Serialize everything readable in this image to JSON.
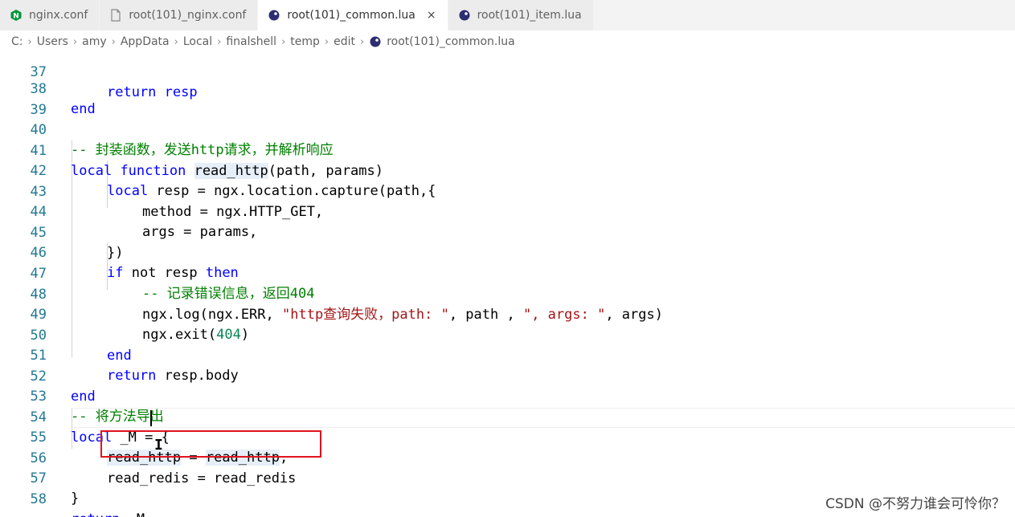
{
  "tabs": [
    {
      "label": "nginx.conf",
      "icon": "nginx-icon",
      "active": false
    },
    {
      "label": "root(101)_nginx.conf",
      "icon": "file-icon",
      "active": false
    },
    {
      "label": "root(101)_common.lua",
      "icon": "lua-icon",
      "active": true,
      "close": "×"
    },
    {
      "label": "root(101)_item.lua",
      "icon": "lua-icon",
      "active": false
    }
  ],
  "breadcrumb": [
    "C:",
    "Users",
    "amy",
    "AppData",
    "Local",
    "finalshell",
    "temp",
    "edit",
    "root(101)_common.lua"
  ],
  "breadcrumb_sep": "›",
  "line_numbers": [
    "37",
    "38",
    "39",
    "40",
    "41",
    "42",
    "43",
    "44",
    "45",
    "46",
    "47",
    "48",
    "49",
    "50",
    "51",
    "52",
    "53",
    "54",
    "55",
    "56",
    "57",
    "58"
  ],
  "code": {
    "l37": "return resp",
    "l38_end": "end",
    "l40_comment": "-- 封装函数，发送http请求，并解析响应",
    "l41_local": "local",
    "l41_function": "function",
    "l41_name": "read_http",
    "l41_args": "(path, params)",
    "l42_local": "local",
    "l42_rest": " resp = ngx.location.capture(path,{",
    "l43": "method = ngx.HTTP_GET,",
    "l44": "args = params,",
    "l45": "})",
    "l46_if": "if",
    "l46_not": " not resp ",
    "l46_then": "then",
    "l47_comment_prefix": "-- 记录错误信息，返回",
    "l47_num": "404",
    "l48_pre": "ngx.log(ngx.ERR, ",
    "l48_str1": "\"http查询失败，path: \"",
    "l48_mid": ", path , ",
    "l48_str2": "\", args: \"",
    "l48_post": ", args)",
    "l49_pre": "ngx.exit(",
    "l49_num": "404",
    "l49_post": ")",
    "l50_end": "end",
    "l51_return": "return",
    "l51_rest": " resp.body",
    "l52_end": "end",
    "l53_comment": "-- 将方法导出",
    "l54_local": "local",
    "l54_rest": " _M = {",
    "l55_a": "read_http",
    "l55_eq": " = ",
    "l55_b": "read_http",
    "l55_comma": ",",
    "l56": "read_redis = read_redis",
    "l57": "}",
    "l58_return": "return",
    "l58_rest": " _M"
  },
  "cursor_glyph": "I",
  "watermark": "CSDN @不努力谁会可怜你？",
  "colors": {
    "keyword": "#0000ff",
    "comment": "#008000",
    "string": "#a31515",
    "number": "#098658",
    "line_number": "#237893",
    "highlight_box": "#e0141e"
  }
}
